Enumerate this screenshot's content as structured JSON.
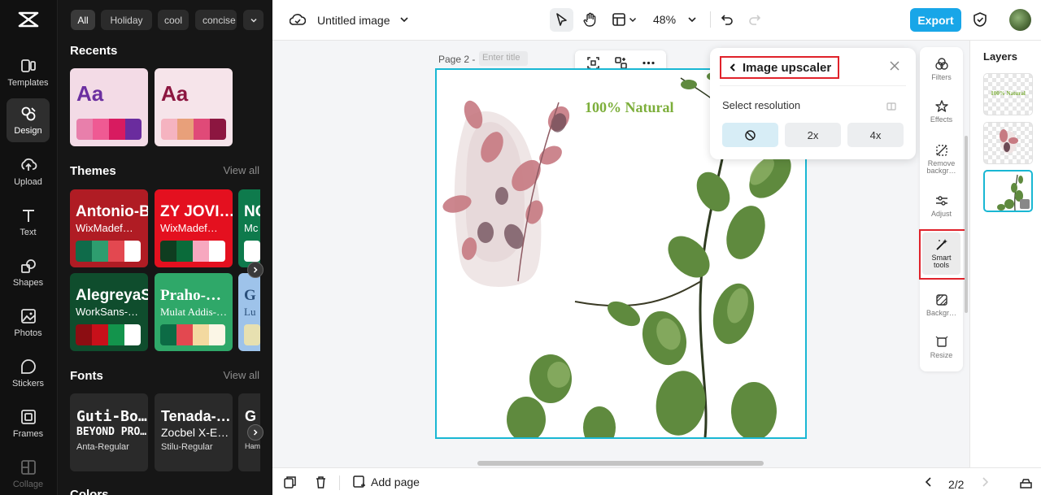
{
  "nav": {
    "items": [
      {
        "label": "Templates",
        "icon": "templates-icon"
      },
      {
        "label": "Design",
        "icon": "design-icon",
        "active": true
      },
      {
        "label": "Upload",
        "icon": "upload-icon"
      },
      {
        "label": "Text",
        "icon": "text-icon"
      },
      {
        "label": "Shapes",
        "icon": "shapes-icon"
      },
      {
        "label": "Photos",
        "icon": "photos-icon"
      },
      {
        "label": "Stickers",
        "icon": "stickers-icon"
      },
      {
        "label": "Frames",
        "icon": "frames-icon"
      },
      {
        "label": "Collage",
        "icon": "collage-icon"
      }
    ]
  },
  "panel": {
    "chips": [
      "All",
      "Holiday",
      "cool",
      "concise"
    ],
    "recents_title": "Recents",
    "recents": [
      {
        "label": "Aa",
        "text_color": "#6b2fa0",
        "bg": "#f3dbe6",
        "swatches": [
          "#e87fab",
          "#ef5a93",
          "#d81b60",
          "#6a2c9e"
        ]
      },
      {
        "label": "Aa",
        "text_color": "#8c1640",
        "bg": "#f6e4ea",
        "swatches": [
          "#f5b3c0",
          "#e8a07a",
          "#e04a78",
          "#8c1640"
        ]
      }
    ],
    "themes_title": "Themes",
    "themes_view_all": "View all",
    "themes": [
      {
        "title": "Antonio-Bold",
        "sub": "WixMadef…",
        "bg": "#b01c24",
        "fg": "#ffffff",
        "swatches": [
          "#0f6b4a",
          "#2e9d6f",
          "#e34850",
          "#ffffff"
        ]
      },
      {
        "title": "ZY JOVI…",
        "sub": "WixMadef…",
        "bg": "#e4101f",
        "fg": "#ffffff",
        "swatches": [
          "#0f3d20",
          "#0a6b3a",
          "#f7a8bf",
          "#ffffff"
        ]
      },
      {
        "title": "NC",
        "sub": "Mc",
        "bg": "#0e7a4c",
        "fg": "#ffffff",
        "swatches": [
          "#ffffff"
        ]
      },
      {
        "title": "AlegreyaS…",
        "sub": "WorkSans-…",
        "bg": "#0f4d2d",
        "fg": "#ffffff",
        "swatches": [
          "#8c0d12",
          "#c8101a",
          "#13944c",
          "#ffffff"
        ]
      },
      {
        "title": "Praho-…",
        "sub": "Mulat Addis-…",
        "bg": "#2fa869",
        "fg": "#ffffff",
        "swatches": [
          "#0c6b45",
          "#e34850",
          "#f3d9a0",
          "#fbf6e6"
        ]
      },
      {
        "title": "G",
        "sub": "Lu",
        "bg": "#9ec3ea",
        "fg": "#2a4f7a",
        "swatches": [
          "#e7e0b0"
        ]
      }
    ],
    "fonts_title": "Fonts",
    "fonts_view_all": "View all",
    "fonts": [
      {
        "title": "Guti-Bo…",
        "sub": "BEYOND PRO…",
        "name": "Anta-Regular"
      },
      {
        "title": "Tenada-…",
        "sub": "Zocbel X-E…",
        "name": "Stilu-Regular"
      },
      {
        "title": "G",
        "sub": "",
        "name": "Ham"
      }
    ],
    "colors_title": "Colors"
  },
  "topbar": {
    "doc_title": "Untitled image",
    "zoom": "48%",
    "export_label": "Export"
  },
  "canvas": {
    "page_label": "Page 2 -",
    "title_placeholder": "Enter title",
    "heading_text": "100% Natural"
  },
  "upscaler": {
    "title": "Image upscaler",
    "subtitle": "Select resolution",
    "options": [
      "",
      "2x",
      "4x"
    ],
    "selected_index": 0
  },
  "rail": {
    "items": [
      {
        "label": "Filters",
        "icon": "filters-icon"
      },
      {
        "label": "Effects",
        "icon": "effects-icon"
      },
      {
        "label": "Remove backgr…",
        "icon": "remove-background-icon"
      },
      {
        "label": "Adjust",
        "icon": "adjust-icon"
      },
      {
        "label": "Smart tools",
        "icon": "smart-tools-icon",
        "active": true
      },
      {
        "label": "Backgr…",
        "icon": "background-icon"
      },
      {
        "label": "Resize",
        "icon": "resize-icon"
      }
    ]
  },
  "layers": {
    "title": "Layers",
    "thumb_text": "100% Natural",
    "selected_index": 2
  },
  "bottombar": {
    "add_page": "Add page",
    "page_counter": "2/2"
  },
  "colors": {
    "accent": "#18a6e8",
    "selection": "#19b7d3",
    "highlight_red": "#e0222a"
  }
}
